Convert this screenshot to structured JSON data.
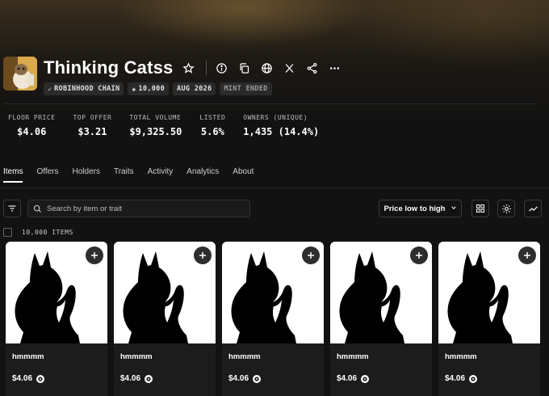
{
  "collection": {
    "title": "Thinking Catss",
    "tags": [
      {
        "label": "ROBINHOOD CHAIN",
        "icon": "feather-icon"
      },
      {
        "label": "10,000",
        "icon": "layers-icon"
      },
      {
        "label": "AUG 2026",
        "icon": ""
      },
      {
        "label": "MINT ENDED",
        "icon": ""
      }
    ]
  },
  "stats": [
    {
      "label": "FLOOR PRICE",
      "value": "$4.06"
    },
    {
      "label": "TOP OFFER",
      "value": "$3.21"
    },
    {
      "label": "TOTAL VOLUME",
      "value": "$9,325.50"
    },
    {
      "label": "LISTED",
      "value": "5.6%"
    },
    {
      "label": "OWNERS (UNIQUE)",
      "value": "1,435 (14.4%)"
    }
  ],
  "tabs": [
    "Items",
    "Offers",
    "Holders",
    "Traits",
    "Activity",
    "Analytics",
    "About"
  ],
  "active_tab": "Items",
  "search": {
    "placeholder": "Search by item or trait"
  },
  "sort": {
    "label": "Price low to high"
  },
  "items_count": "10,000 ITEMS",
  "items": [
    {
      "name": "hmmmm",
      "price": "$4.06"
    },
    {
      "name": "hmmmm",
      "price": "$4.06"
    },
    {
      "name": "hmmmm",
      "price": "$4.06"
    },
    {
      "name": "hmmmm",
      "price": "$4.06"
    },
    {
      "name": "hmmmm",
      "price": "$4.06"
    }
  ],
  "colors": {
    "background": "#121212",
    "card": "#1c1c1c",
    "text": "#ffffff"
  }
}
